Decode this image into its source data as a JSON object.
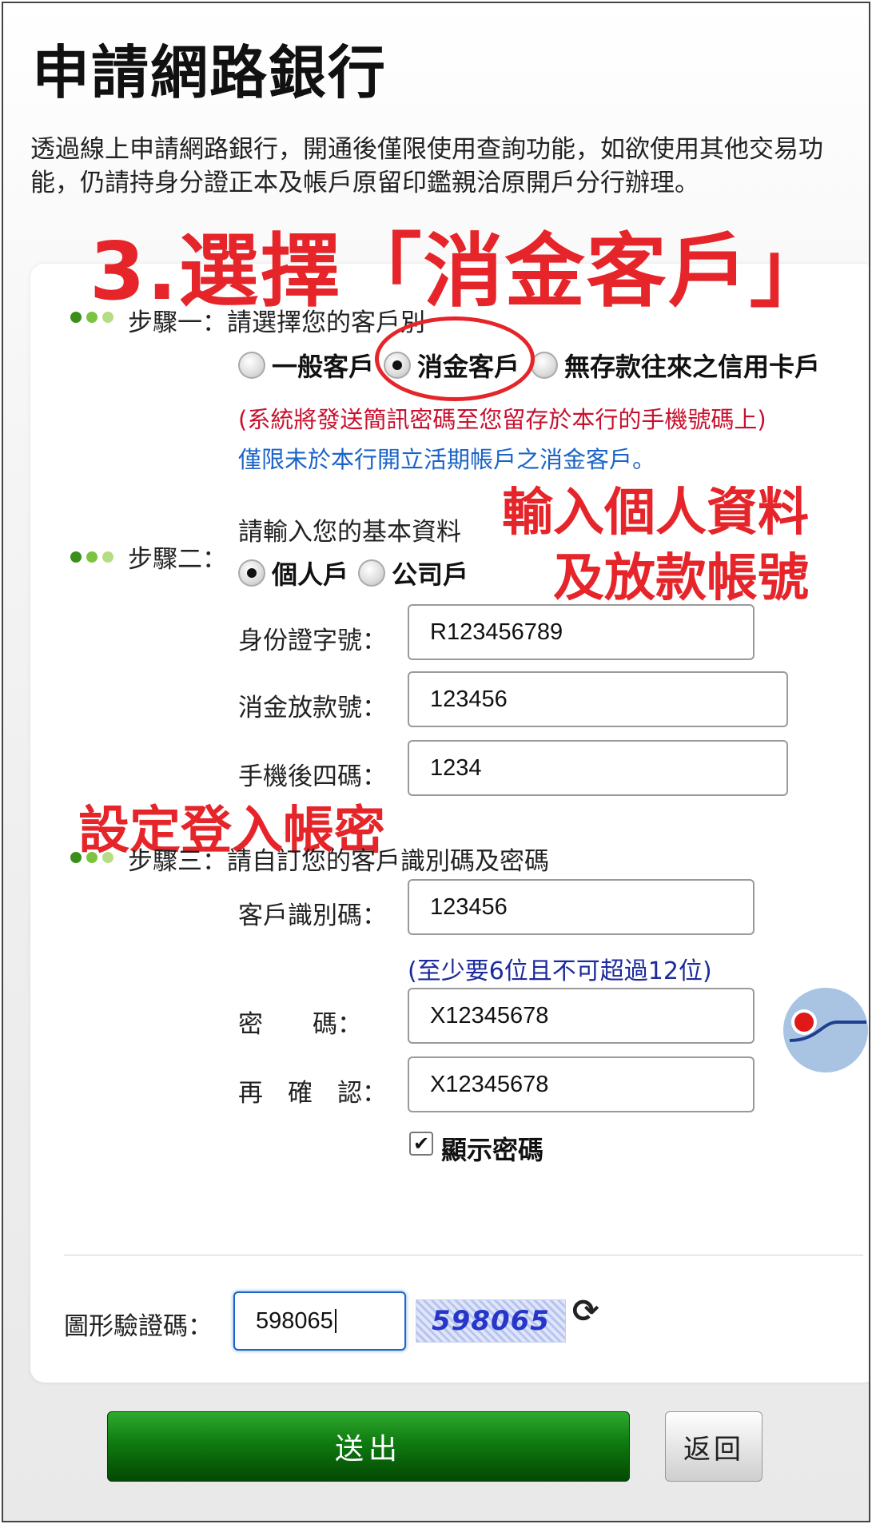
{
  "page": {
    "title": "申請網路銀行",
    "intro": "透過線上申請網路銀行，開通後僅限使用查詢功能，如欲使用其他交易功能，仍請持身分證正本及帳戶原留印鑑親洽原開戶分行辦理。"
  },
  "annotations": {
    "select_type": "3.選擇「消金客戶」",
    "enter_info_line1": "輸入個人資料",
    "enter_info_line2": "及放款帳號",
    "set_login": "設定登入帳密"
  },
  "step1": {
    "label": "步驟一：請選擇您的客戶別",
    "options": [
      "一般客戶",
      "消金客戶",
      "無存款往來之信用卡戶"
    ],
    "selected": "消金客戶",
    "sms_note": "(系統將發送簡訊密碼至您留存於本行的手機號碼上)",
    "limit_note": "僅限未於本行開立活期帳戶之消金客戶。"
  },
  "step2": {
    "label_prefix": "步驟二：",
    "prompt": "請輸入您的基本資料",
    "options": [
      "個人戶",
      "公司戶"
    ],
    "selected": "個人戶",
    "fields": {
      "id_label": "身份證字號：",
      "id_value": "R123456789",
      "loan_label": "消金放款號：",
      "loan_value": "123456",
      "phone_label": "手機後四碼：",
      "phone_value": "1234"
    }
  },
  "step3": {
    "label": "步驟三：請自訂您的客戶識別碼及密碼",
    "user_id_label": "客戶識別碼：",
    "user_id_value": "123456",
    "length_note": "(至少要6位且不可超過12位)",
    "password_label": "密　　碼：",
    "password_value": "X12345678",
    "confirm_label": "再　確　認：",
    "confirm_value": "X12345678",
    "show_password_label": "顯示密碼",
    "show_password_checked": true
  },
  "captcha": {
    "label": "圖形驗證碼：",
    "input_value": "598065",
    "image_text": "598065",
    "refresh_icon": "refresh-icon"
  },
  "buttons": {
    "submit": "送出",
    "back": "返回"
  },
  "colors": {
    "annotation_red": "#e5252a",
    "note_red": "#c8102e",
    "note_blue": "#1a64c8",
    "submit_green": "#0f7a10"
  }
}
